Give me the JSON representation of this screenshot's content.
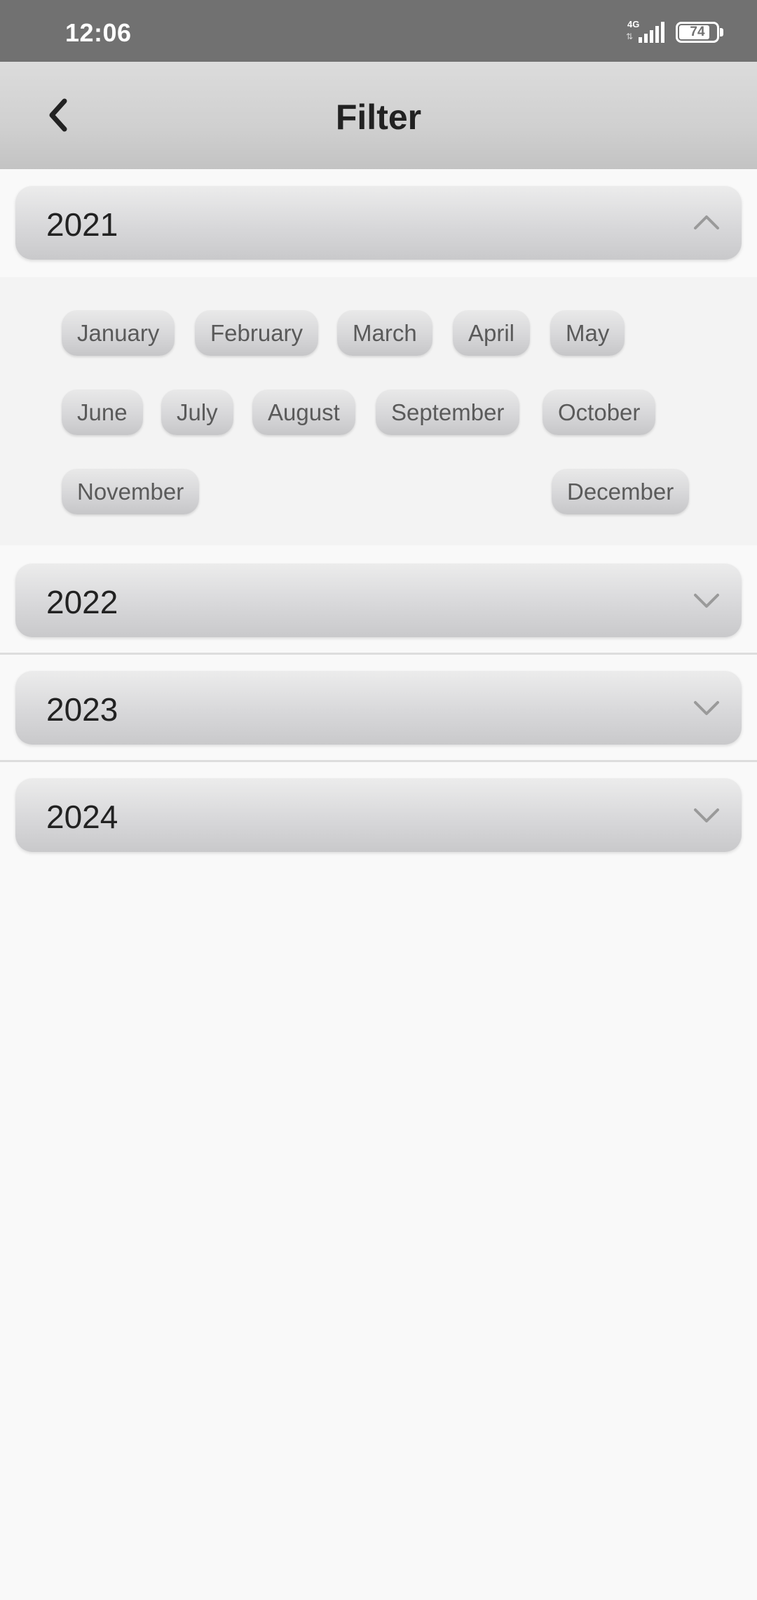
{
  "status_bar": {
    "time": "12:06",
    "network": "4G",
    "network_arrows": "⇅",
    "battery": "74"
  },
  "app_bar": {
    "back_icon": "chevron-left-icon",
    "title": "Filter"
  },
  "years": [
    {
      "label": "2021",
      "expanded": true,
      "chevron": "chevron-up-icon"
    },
    {
      "label": "2022",
      "expanded": false,
      "chevron": "chevron-down-icon"
    },
    {
      "label": "2023",
      "expanded": false,
      "chevron": "chevron-down-icon"
    },
    {
      "label": "2024",
      "expanded": false,
      "chevron": "chevron-down-icon"
    }
  ],
  "months": [
    "January",
    "February",
    "March",
    "April",
    "May",
    "June",
    "July",
    "August",
    "September",
    "October",
    "November",
    "December"
  ],
  "colors": {
    "status_bar": "#717171",
    "app_bar_top": "#dcdcdc",
    "app_bar_bottom": "#c3c3c3",
    "background": "#f9f9f9",
    "chip_text": "#5a5a5a",
    "chevron": "#9a9a9a"
  }
}
